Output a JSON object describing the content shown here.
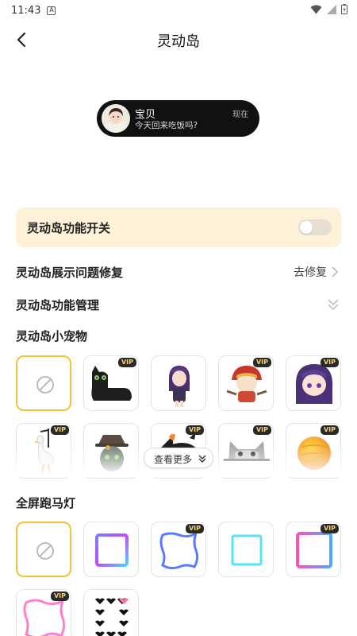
{
  "status_bar": {
    "time": "11:43",
    "notif_letter": "A"
  },
  "header": {
    "title": "灵动岛"
  },
  "preview": {
    "name": "宝贝",
    "message": "今天回来吃饭吗?",
    "time": "现在"
  },
  "switch": {
    "label": "灵动岛功能开关",
    "enabled": false
  },
  "repair": {
    "label": "灵动岛展示问题修复",
    "action": "去修复"
  },
  "manage": {
    "label": "灵动岛功能管理"
  },
  "pets": {
    "title": "灵动岛小宠物",
    "more_label": "查看更多",
    "items": [
      {
        "name": "none",
        "vip": false,
        "selected": true
      },
      {
        "name": "black-cat",
        "vip": true
      },
      {
        "name": "purple-hair-girl",
        "vip": false
      },
      {
        "name": "red-hat-girl",
        "vip": true
      },
      {
        "name": "purple-hair-chibi",
        "vip": true
      },
      {
        "name": "white-goose",
        "vip": true
      },
      {
        "name": "hat-creature",
        "vip": false
      },
      {
        "name": "penguin",
        "vip": true
      },
      {
        "name": "grey-cat",
        "vip": true
      },
      {
        "name": "orange-ball",
        "vip": true
      }
    ]
  },
  "marquee": {
    "title": "全屏跑马灯",
    "items": [
      {
        "name": "none",
        "vip": false,
        "selected": true
      },
      {
        "name": "gradient-square",
        "vip": false
      },
      {
        "name": "wavy-blue-frame",
        "vip": true
      },
      {
        "name": "cyan-square",
        "vip": false
      },
      {
        "name": "pink-blue-frame",
        "vip": true
      },
      {
        "name": "wavy-pink-frame",
        "vip": true
      },
      {
        "name": "heart-frame",
        "vip": false
      }
    ]
  },
  "vip_label": "VIP",
  "colors": {
    "accent": "#f2c23a",
    "card_bg": "#fdf2d8",
    "pill_bg": "#111111"
  }
}
